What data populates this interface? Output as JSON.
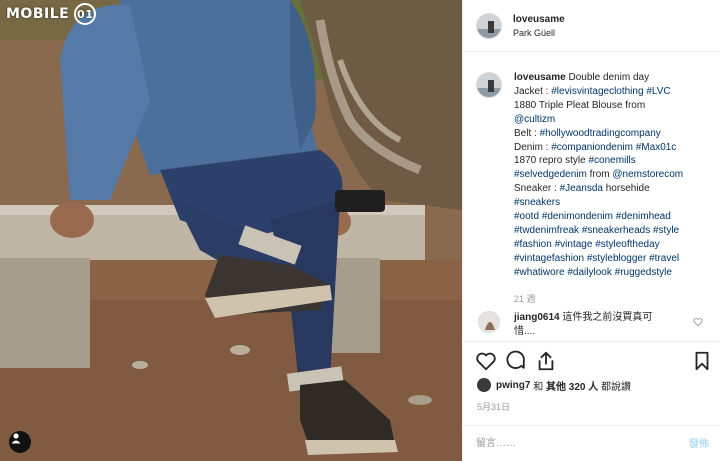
{
  "watermark": {
    "text": "MOBILE",
    "badge": "01"
  },
  "post": {
    "username": "loveusame",
    "location": "Park Güell",
    "caption": {
      "username": "loveusame",
      "lines": [
        [
          {
            "t": "Double denim day",
            "tag": false
          }
        ],
        [
          {
            "t": "Jacket : ",
            "tag": false
          },
          {
            "t": "#levisvintageclothing",
            "tag": true
          },
          {
            "t": " ",
            "tag": false
          },
          {
            "t": "#LVC",
            "tag": true
          }
        ],
        [
          {
            "t": "1880 Triple Pleat Blouse from",
            "tag": false
          }
        ],
        [
          {
            "t": "@cultizm",
            "tag": true
          }
        ],
        [
          {
            "t": "Belt : ",
            "tag": false
          },
          {
            "t": "#hollywoodtradingcompany",
            "tag": true
          }
        ],
        [
          {
            "t": "Denim : ",
            "tag": false
          },
          {
            "t": "#companiondenim",
            "tag": true
          },
          {
            "t": " ",
            "tag": false
          },
          {
            "t": "#Max01c",
            "tag": true
          }
        ],
        [
          {
            "t": "1870 repro style ",
            "tag": false
          },
          {
            "t": "#conemills",
            "tag": true
          }
        ],
        [
          {
            "t": "#selvedgedenim",
            "tag": true
          },
          {
            "t": " from ",
            "tag": false
          },
          {
            "t": "@nemstorecom",
            "tag": true
          }
        ],
        [
          {
            "t": "Sneaker : ",
            "tag": false
          },
          {
            "t": "#Jeansda",
            "tag": true
          },
          {
            "t": " horsehide",
            "tag": false
          }
        ],
        [
          {
            "t": "#sneakers",
            "tag": true
          }
        ],
        [
          {
            "t": "#ootd",
            "tag": true
          },
          {
            "t": " ",
            "tag": false
          },
          {
            "t": "#denimondenim",
            "tag": true
          },
          {
            "t": " ",
            "tag": false
          },
          {
            "t": "#denimhead",
            "tag": true
          }
        ],
        [
          {
            "t": "#twdenimfreak",
            "tag": true
          },
          {
            "t": " ",
            "tag": false
          },
          {
            "t": "#sneakerheads",
            "tag": true
          },
          {
            "t": " ",
            "tag": false
          },
          {
            "t": "#style",
            "tag": true
          }
        ],
        [
          {
            "t": "#fashion",
            "tag": true
          },
          {
            "t": " ",
            "tag": false
          },
          {
            "t": "#vintage",
            "tag": true
          },
          {
            "t": " ",
            "tag": false
          },
          {
            "t": "#styleoftheday",
            "tag": true
          }
        ],
        [
          {
            "t": "#vintagefashion",
            "tag": true
          },
          {
            "t": " ",
            "tag": false
          },
          {
            "t": "#styleblogger",
            "tag": true
          },
          {
            "t": " ",
            "tag": false
          },
          {
            "t": "#travel",
            "tag": true
          }
        ],
        [
          {
            "t": "#whatiwore",
            "tag": true
          },
          {
            "t": " ",
            "tag": false
          },
          {
            "t": "#dailylook",
            "tag": true
          },
          {
            "t": " ",
            "tag": false
          },
          {
            "t": "#ruggedstyle",
            "tag": true
          }
        ]
      ],
      "time_ago": "21 週"
    },
    "comment": {
      "username": "jiang0614",
      "line1": "這件我之前沒買真可",
      "line2": "惜....",
      "like_icon": "heart-outline-icon"
    },
    "actions": {
      "like_icon": "heart-icon",
      "comment_icon": "comment-icon",
      "share_icon": "share-icon",
      "save_icon": "bookmark-icon"
    },
    "likes": {
      "user": "pwing7",
      "and": " 和 ",
      "others": "其他 320 人",
      "suffix": " 都說讚"
    },
    "date": "5月31日",
    "comment_input": {
      "placeholder": "留言……",
      "post_label": "發佈"
    }
  },
  "colors": {
    "hashtag": "#003569",
    "border": "#efefef",
    "muted": "#999999",
    "post_button": "#b2dffc"
  }
}
